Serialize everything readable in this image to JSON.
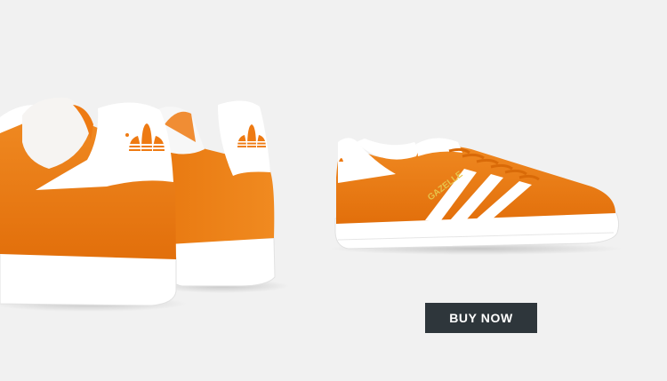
{
  "banner": {
    "background": "#f1f1f1",
    "product_color": "#ee7a12",
    "sole_color": "#ffffff",
    "images": [
      {
        "name": "sneakers-back-view",
        "description_icon": "trefoil-logo"
      },
      {
        "name": "sneaker-side-view",
        "model_text": "GAZELLE"
      }
    ],
    "cta": {
      "label": "BUY NOW",
      "background": "#2e363b",
      "text_color": "#ffffff"
    }
  }
}
